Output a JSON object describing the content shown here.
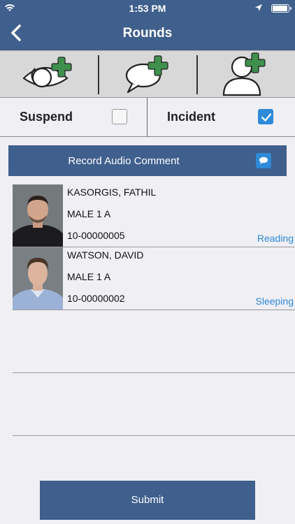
{
  "status_bar": {
    "time": "1:53 PM"
  },
  "nav": {
    "title": "Rounds"
  },
  "actions": [
    {
      "icon": "eye-add-icon"
    },
    {
      "icon": "comment-add-icon"
    },
    {
      "icon": "person-add-icon"
    }
  ],
  "toggles": {
    "suspend": {
      "label": "Suspend",
      "checked": false
    },
    "incident": {
      "label": "Incident",
      "checked": true
    }
  },
  "record": {
    "label": "Record Audio Comment",
    "icon": "speech-bubble-icon"
  },
  "inmates": [
    {
      "name": "KASORGIS, FATHIL",
      "location": "MALE 1 A",
      "number": "10-00000005",
      "status": "Reading"
    },
    {
      "name": "WATSON, DAVID",
      "location": "MALE 1 A",
      "number": "10-00000002",
      "status": "Sleeping"
    }
  ],
  "submit": {
    "label": "Submit"
  },
  "colors": {
    "header": "#3f5f8c",
    "accent": "#2f8ad8",
    "plus": "#3f8f4d"
  }
}
